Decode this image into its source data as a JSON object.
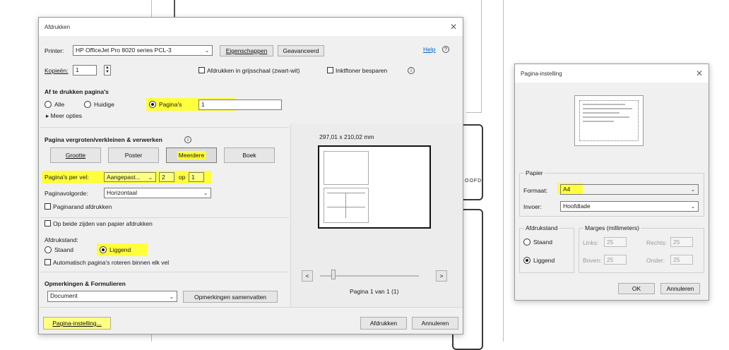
{
  "print_dialog": {
    "title": "Afdrukken",
    "printer_label": "Printer:",
    "printer_value": "HP OfficeJet Pro 8020 series PCL-3",
    "properties_button": "Eigenschappen",
    "advanced_button": "Geavanceerd",
    "help_link": "Help",
    "copies_label": "Kopieën:",
    "copies_value": "1",
    "grayscale_label": "Afdrukken in grijsschaal (zwart-wit)",
    "save_ink_label": "Inktftoner besparen",
    "pages_section_title": "Af te drukken pagina's",
    "radio_all": "Alle",
    "radio_current": "Huidige",
    "radio_pages": "Pagina's",
    "pages_value": "1",
    "more_options": "Meer opties",
    "scale_section_title": "Pagina vergroten/verkleinen & verwerken",
    "btn_size": "Grootte",
    "btn_poster": "Poster",
    "btn_multiple": "Meerdere",
    "btn_booklet": "Boek",
    "pages_per_sheet_label": "Pagina's per vel:",
    "pages_per_sheet_value": "Aangepast...",
    "pps_cols": "2",
    "pps_op": "op",
    "pps_rows": "1",
    "page_order_label": "Paginavolgorde:",
    "page_order_value": "Horizontaal",
    "print_border_label": "Paginarand afdrukken",
    "duplex_label": "Op beide zijden van papier afdrukken",
    "orientation_label": "Afdrukstand:",
    "orient_portrait": "Staand",
    "orient_landscape": "Liggend",
    "auto_rotate_label": "Automatisch pagina's roteren binnen elk vel",
    "comments_section_title": "Opmerkingen & Formulieren",
    "comments_value": "Document",
    "summarize_button": "Opmerkingen samenvatten",
    "preview_size": "297,01 x 210,02 mm",
    "page_counter": "Pagina 1 van 1 (1)",
    "page_setup_button": "Pagina-instelling...",
    "print_button": "Afdrukken",
    "cancel_button": "Annuleren",
    "nav_prev": "<",
    "nav_next": ">"
  },
  "page_setup_dialog": {
    "title": "Pagina-instelling",
    "paper_group": "Papier",
    "format_label": "Formaat:",
    "format_value": "A4",
    "source_label": "Invoer:",
    "source_value": "Hoofdlade",
    "orientation_group": "Afdrukstand",
    "portrait": "Staand",
    "landscape": "Liggend",
    "margins_group": "Marges (millimeters)",
    "left_label": "Links:",
    "left_value": "25",
    "right_label": "Rechts:",
    "right_value": "25",
    "top_label": "Boven:",
    "top_value": "25",
    "bottom_label": "Onder:",
    "bottom_value": "25",
    "ok_button": "OK",
    "cancel_button": "Annuleren"
  },
  "background": {
    "fragment_text": "OOFD"
  },
  "colors": {
    "highlight": "#ffff3c",
    "dialog_bg": "#f0f0f0",
    "link": "#0066cc"
  }
}
